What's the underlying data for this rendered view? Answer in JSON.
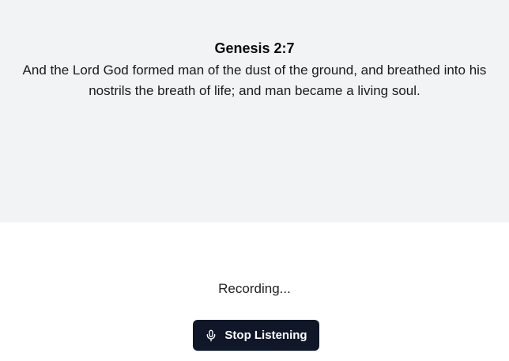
{
  "verse": {
    "reference": "Genesis 2:7",
    "text": "And the Lord God formed man of the dust of the ground, and breathed into his nostrils the breath of life; and man became a living soul."
  },
  "status": {
    "text": "Recording..."
  },
  "controls": {
    "stop_button": {
      "label": "Stop Listening",
      "icon": "microphone-icon"
    }
  },
  "colors": {
    "panel_background": "#f2f3f5",
    "page_background": "#ffffff",
    "button_background": "#0f1729",
    "button_text": "#ffffff"
  }
}
